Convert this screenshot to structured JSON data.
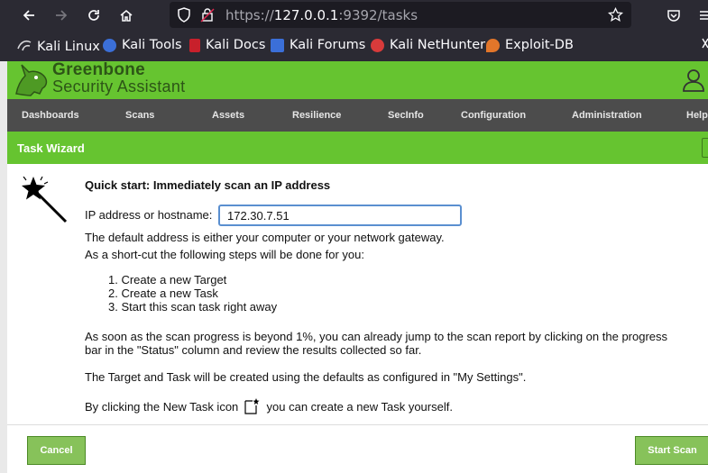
{
  "browser": {
    "url_prefix": "https://",
    "url_host": "127.0.0.1",
    "url_rest": ":9392/tasks",
    "bookmarks": [
      "Kali Linux",
      "Kali Tools",
      "Kali Docs",
      "Kali Forums",
      "Kali NetHunter",
      "Exploit-DB"
    ]
  },
  "app": {
    "logo_line1": "Greenbone",
    "logo_line2": "Security Assistant",
    "menu": [
      "Dashboards",
      "Scans",
      "Assets",
      "Resilience",
      "SecInfo",
      "Configuration",
      "Administration",
      "Help"
    ]
  },
  "wizard": {
    "title": "Task Wizard",
    "heading": "Quick start: Immediately scan an IP address",
    "ip_label": "IP address or hostname:",
    "ip_value": "172.30.7.51",
    "default_note": "The default address is either your computer or your network gateway.",
    "shortcut_intro": "As a short-cut the following steps will be done for you:",
    "steps": [
      "1. Create a new Target",
      "2. Create a new Task",
      "3. Start this scan task right away"
    ],
    "progress_note_1": "As soon as the scan progress is beyond 1%, you can already jump to the scan report by clicking on the progress",
    "progress_note_2": "bar in the \"Status\" column and review the results collected so far.",
    "defaults_note": "The Target and Task will be created using the defaults as configured in \"My Settings\".",
    "new_task_note_a": "By clicking the New Task icon",
    "new_task_note_b": "you can create a new Task yourself.",
    "cancel_label": "Cancel",
    "start_label": "Start Scan"
  },
  "colors": {
    "greenbone_green": "#66c430",
    "menu_bg": "#4c4c4c",
    "browser_chrome": "#2b2a33"
  }
}
